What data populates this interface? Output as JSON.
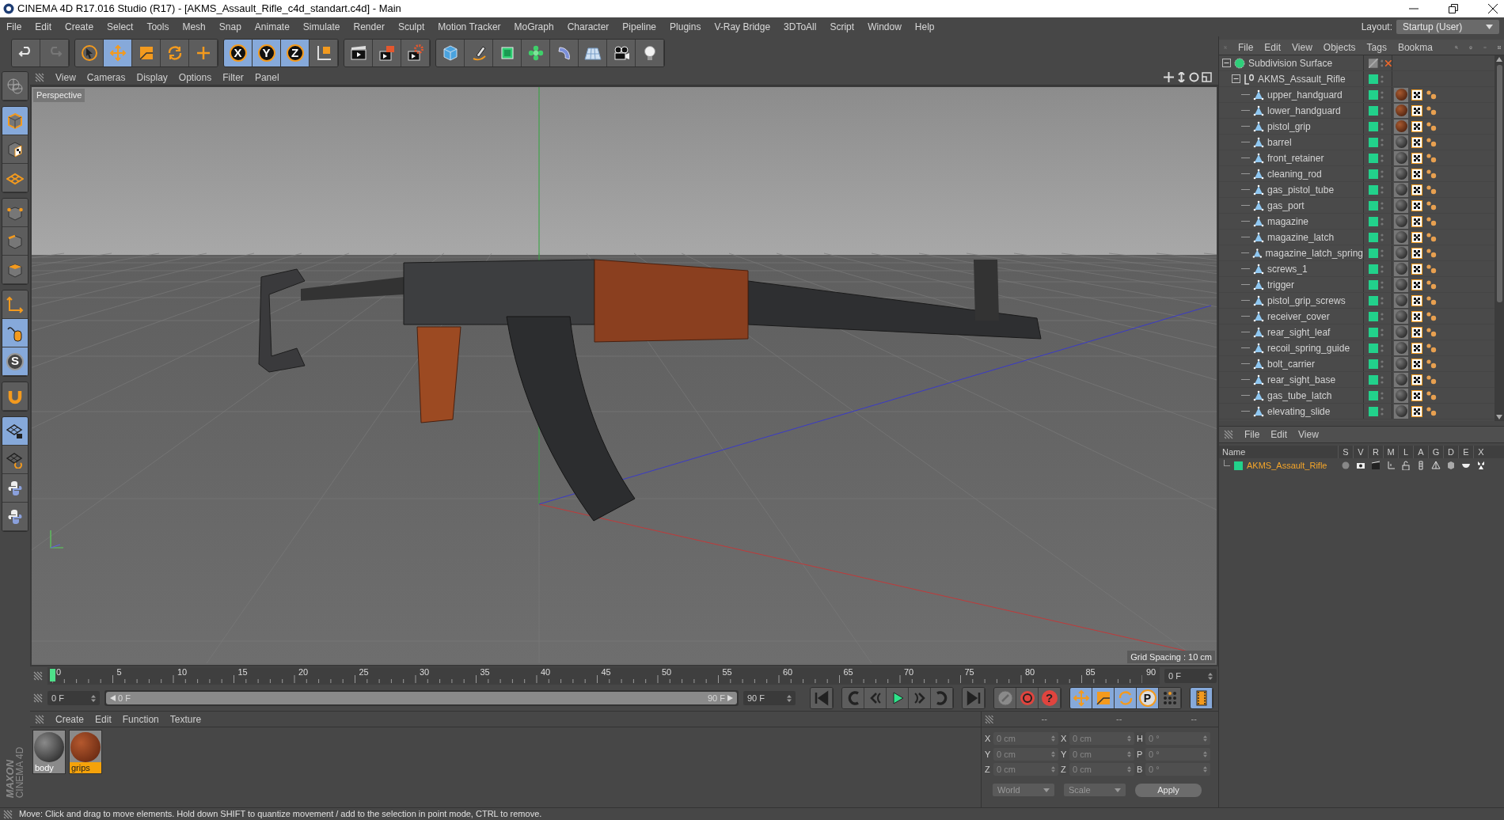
{
  "window": {
    "title": "CINEMA 4D R17.016 Studio (R17) - [AKMS_Assault_Rifle_c4d_standart.c4d] - Main"
  },
  "menu": [
    "File",
    "Edit",
    "Create",
    "Select",
    "Tools",
    "Mesh",
    "Snap",
    "Animate",
    "Simulate",
    "Render",
    "Sculpt",
    "Motion Tracker",
    "MoGraph",
    "Character",
    "Pipeline",
    "Plugins",
    "V-Ray Bridge",
    "3DToAll",
    "Script",
    "Window",
    "Help"
  ],
  "layout": {
    "label": "Layout:",
    "value": "Startup (User)"
  },
  "toolbar": [
    [
      {
        "kind": "undo",
        "selected": false
      },
      {
        "kind": "redo",
        "selected": false
      }
    ],
    [
      {
        "kind": "pointer",
        "selected": false
      },
      {
        "kind": "move",
        "selected": true
      },
      {
        "kind": "scale",
        "selected": false
      },
      {
        "kind": "rotate",
        "selected": false
      },
      {
        "kind": "add",
        "selected": false
      }
    ],
    [
      {
        "kind": "axis",
        "label": "X",
        "selected": true
      },
      {
        "kind": "axis",
        "label": "Y",
        "selected": true
      },
      {
        "kind": "axis",
        "label": "Z",
        "selected": true
      },
      {
        "kind": "coord",
        "selected": false
      }
    ],
    [
      {
        "kind": "render_view",
        "selected": false
      },
      {
        "kind": "render",
        "selected": false
      },
      {
        "kind": "render_settings",
        "selected": false
      }
    ],
    [
      {
        "kind": "cube",
        "selected": false
      },
      {
        "kind": "pen",
        "selected": false
      },
      {
        "kind": "subdiv",
        "selected": false
      },
      {
        "kind": "cloner",
        "selected": false
      },
      {
        "kind": "deformer",
        "selected": false
      },
      {
        "kind": "floor",
        "selected": false
      },
      {
        "kind": "camera",
        "selected": false
      },
      {
        "kind": "light",
        "selected": false
      }
    ]
  ],
  "left_toolbar": [
    [
      {
        "kind": "globe",
        "selected": false
      }
    ],
    [
      {
        "kind": "model",
        "selected": true
      },
      {
        "kind": "texture",
        "selected": false
      },
      {
        "kind": "workplane",
        "selected": false
      }
    ],
    [
      {
        "kind": "points",
        "selected": false
      },
      {
        "kind": "edges",
        "selected": false
      },
      {
        "kind": "polygons",
        "selected": false
      }
    ],
    [
      {
        "kind": "axes",
        "selected": false
      },
      {
        "kind": "tweak",
        "selected": true
      },
      {
        "kind": "snap",
        "label": "S",
        "selected": true
      }
    ],
    [
      {
        "kind": "magnet",
        "selected": false
      }
    ],
    [
      {
        "kind": "grid_lock",
        "selected": true
      },
      {
        "kind": "grid_rotate",
        "selected": false
      },
      {
        "kind": "python",
        "selected": false
      },
      {
        "kind": "python",
        "selected": false
      }
    ]
  ],
  "brand": [
    "MAXON",
    "CINEMA 4D"
  ],
  "viewport": {
    "menu": [
      "View",
      "Cameras",
      "Display",
      "Options",
      "Filter",
      "Panel"
    ],
    "camera": "Perspective",
    "grid_spacing": "Grid Spacing : 10 cm"
  },
  "timeline": {
    "range": {
      "level": 1
    },
    "ticks": [
      "0",
      "5",
      "10",
      "15",
      "20",
      "25",
      "30",
      "35",
      "40",
      "45",
      "50",
      "55",
      "60",
      "65",
      "70",
      "75",
      "80",
      "85",
      "90"
    ],
    "playhead": {
      "level": 0
    },
    "current": "0 F",
    "start": "0 F",
    "range_start": "0 F",
    "range_end": "90 F",
    "end": "90 F"
  },
  "transport": [
    [
      {
        "kind": "first",
        "selected": false
      }
    ],
    [
      {
        "kind": "prev_key",
        "selected": false
      },
      {
        "kind": "prev_frame",
        "selected": false
      },
      {
        "kind": "play",
        "selected": false
      },
      {
        "kind": "next_frame",
        "selected": false
      },
      {
        "kind": "next_key",
        "selected": false
      }
    ],
    [
      {
        "kind": "last",
        "selected": false
      }
    ],
    [
      {
        "kind": "record_off",
        "selected": false
      },
      {
        "kind": "record",
        "selected": false
      },
      {
        "kind": "keyframe_help",
        "label": "?",
        "selected": false
      }
    ],
    [
      {
        "kind": "key_move",
        "selected": true
      },
      {
        "kind": "key_scale",
        "selected": true
      },
      {
        "kind": "key_rotate",
        "selected": true
      },
      {
        "kind": "key_param",
        "label": "P",
        "selected": true
      },
      {
        "kind": "key_points",
        "selected": false
      }
    ],
    [
      {
        "kind": "film",
        "selected": true
      }
    ]
  ],
  "materials": {
    "menu": [
      "Create",
      "Edit",
      "Function",
      "Texture"
    ],
    "items": [
      {
        "name": "body",
        "kind": "metal",
        "selected": false
      },
      {
        "name": "grips",
        "kind": "wood",
        "selected": true
      }
    ]
  },
  "coordinates": {
    "header": [
      "--",
      "--",
      "--"
    ],
    "rows": [
      {
        "axis": "X",
        "position": "0 cm",
        "axis_2": "X",
        "size": "0 cm",
        "axis_3": "H",
        "rotation": "0 °"
      },
      {
        "axis": "Y",
        "position": "0 cm",
        "axis_2": "Y",
        "size": "0 cm",
        "axis_3": "P",
        "rotation": "0 °"
      },
      {
        "axis": "Z",
        "position": "0 cm",
        "axis_2": "Z",
        "size": "0 cm",
        "axis_3": "B",
        "rotation": "0 °"
      }
    ],
    "space": "World",
    "mode": "Scale",
    "apply": "Apply"
  },
  "objects": {
    "menu": [
      "File",
      "Edit",
      "View",
      "Objects",
      "Tags",
      "Bookma"
    ],
    "tree": [
      {
        "name": "Subdivision Surface",
        "kind": "subdivision",
        "expanded": true,
        "children": [
          {
            "name": "AKMS_Assault_Rifle",
            "kind": "null",
            "expanded": true,
            "children": [
              {
                "name": "upper_handguard",
                "kind": "polygon",
                "tags": [
                  {
                    "kind": "wood_material"
                  },
                  {
                    "kind": "texture"
                  },
                  {
                    "kind": "phong"
                  }
                ]
              },
              {
                "name": "lower_handguard",
                "kind": "polygon",
                "tags": [
                  {
                    "kind": "wood_material"
                  },
                  {
                    "kind": "texture"
                  },
                  {
                    "kind": "phong"
                  }
                ]
              },
              {
                "name": "pistol_grip",
                "kind": "polygon",
                "tags": [
                  {
                    "kind": "wood_material"
                  },
                  {
                    "kind": "texture"
                  },
                  {
                    "kind": "phong"
                  }
                ]
              },
              {
                "name": "barrel",
                "kind": "polygon",
                "tags": [
                  {
                    "kind": "metal_material"
                  },
                  {
                    "kind": "texture"
                  },
                  {
                    "kind": "phong"
                  }
                ]
              },
              {
                "name": "front_retainer",
                "kind": "polygon",
                "tags": [
                  {
                    "kind": "metal_material"
                  },
                  {
                    "kind": "texture"
                  },
                  {
                    "kind": "phong"
                  }
                ]
              },
              {
                "name": "cleaning_rod",
                "kind": "polygon",
                "tags": [
                  {
                    "kind": "metal_material"
                  },
                  {
                    "kind": "texture"
                  },
                  {
                    "kind": "phong"
                  }
                ]
              },
              {
                "name": "gas_pistol_tube",
                "kind": "polygon",
                "tags": [
                  {
                    "kind": "metal_material"
                  },
                  {
                    "kind": "texture"
                  },
                  {
                    "kind": "phong"
                  }
                ]
              },
              {
                "name": "gas_port",
                "kind": "polygon",
                "tags": [
                  {
                    "kind": "metal_material"
                  },
                  {
                    "kind": "texture"
                  },
                  {
                    "kind": "phong"
                  }
                ]
              },
              {
                "name": "magazine",
                "kind": "polygon",
                "tags": [
                  {
                    "kind": "metal_material"
                  },
                  {
                    "kind": "texture"
                  },
                  {
                    "kind": "phong"
                  }
                ]
              },
              {
                "name": "magazine_latch",
                "kind": "polygon",
                "tags": [
                  {
                    "kind": "metal_material"
                  },
                  {
                    "kind": "texture"
                  },
                  {
                    "kind": "phong"
                  }
                ]
              },
              {
                "name": "magazine_latch_spring",
                "kind": "polygon",
                "tags": [
                  {
                    "kind": "metal_material"
                  },
                  {
                    "kind": "texture"
                  },
                  {
                    "kind": "phong"
                  }
                ]
              },
              {
                "name": "screws_1",
                "kind": "polygon",
                "tags": [
                  {
                    "kind": "metal_material"
                  },
                  {
                    "kind": "texture"
                  },
                  {
                    "kind": "phong"
                  }
                ]
              },
              {
                "name": "trigger",
                "kind": "polygon",
                "tags": [
                  {
                    "kind": "metal_material"
                  },
                  {
                    "kind": "texture"
                  },
                  {
                    "kind": "phong"
                  }
                ]
              },
              {
                "name": "pistol_grip_screws",
                "kind": "polygon",
                "tags": [
                  {
                    "kind": "metal_material"
                  },
                  {
                    "kind": "texture"
                  },
                  {
                    "kind": "phong"
                  }
                ]
              },
              {
                "name": "receiver_cover",
                "kind": "polygon",
                "tags": [
                  {
                    "kind": "metal_material"
                  },
                  {
                    "kind": "texture"
                  },
                  {
                    "kind": "phong"
                  }
                ]
              },
              {
                "name": "rear_sight_leaf",
                "kind": "polygon",
                "tags": [
                  {
                    "kind": "metal_material"
                  },
                  {
                    "kind": "texture"
                  },
                  {
                    "kind": "phong"
                  }
                ]
              },
              {
                "name": "recoil_spring_guide",
                "kind": "polygon",
                "tags": [
                  {
                    "kind": "metal_material"
                  },
                  {
                    "kind": "texture"
                  },
                  {
                    "kind": "phong"
                  }
                ]
              },
              {
                "name": "bolt_carrier",
                "kind": "polygon",
                "tags": [
                  {
                    "kind": "metal_material"
                  },
                  {
                    "kind": "texture"
                  },
                  {
                    "kind": "phong"
                  }
                ]
              },
              {
                "name": "rear_sight_base",
                "kind": "polygon",
                "tags": [
                  {
                    "kind": "metal_material"
                  },
                  {
                    "kind": "texture"
                  },
                  {
                    "kind": "phong"
                  }
                ]
              },
              {
                "name": "gas_tube_latch",
                "kind": "polygon",
                "tags": [
                  {
                    "kind": "metal_material"
                  },
                  {
                    "kind": "texture"
                  },
                  {
                    "kind": "phong"
                  }
                ]
              },
              {
                "name": "elevating_slide",
                "kind": "polygon",
                "tags": [
                  {
                    "kind": "metal_material"
                  },
                  {
                    "kind": "texture"
                  },
                  {
                    "kind": "phong"
                  }
                ]
              }
            ]
          }
        ]
      }
    ]
  },
  "layers": {
    "menu": [
      "File",
      "Edit",
      "View"
    ],
    "columns": [
      "Name",
      "S",
      "V",
      "R",
      "M",
      "L",
      "A",
      "G",
      "D",
      "E",
      "X"
    ],
    "rows": [
      {
        "name": "AKMS_Assault_Rifle",
        "color": "#22d18b"
      }
    ]
  },
  "status_bar": "Move: Click and drag to move elements. Hold down SHIFT to quantize movement / add to the selection in point mode, CTRL to remove."
}
